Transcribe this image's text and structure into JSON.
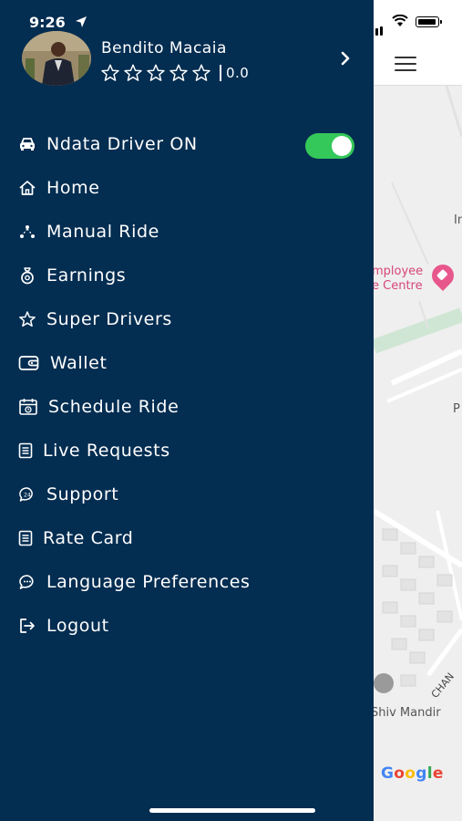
{
  "status_bar": {
    "time": "9:26"
  },
  "profile": {
    "name": "Bendito Macaia",
    "rating": "0.0",
    "stars_total": 5,
    "stars_filled": 0
  },
  "menu": {
    "items": [
      {
        "id": "driver-status",
        "label": "Ndata Driver ON",
        "icon": "car-icon"
      },
      {
        "id": "home",
        "label": "Home",
        "icon": "home-icon"
      },
      {
        "id": "manual-ride",
        "label": "Manual Ride",
        "icon": "route-icon"
      },
      {
        "id": "earnings",
        "label": "Earnings",
        "icon": "money-bag-icon"
      },
      {
        "id": "super-drivers",
        "label": "Super Drivers",
        "icon": "star-icon"
      },
      {
        "id": "wallet",
        "label": "Wallet",
        "icon": "wallet-icon"
      },
      {
        "id": "schedule-ride",
        "label": "Schedule Ride",
        "icon": "calendar-icon"
      },
      {
        "id": "live-requests",
        "label": "Live Requests",
        "icon": "list-icon"
      },
      {
        "id": "support",
        "label": "Support",
        "icon": "support-icon"
      },
      {
        "id": "rate-card",
        "label": "Rate Card",
        "icon": "list-icon"
      },
      {
        "id": "language",
        "label": "Language Preferences",
        "icon": "chat-icon"
      },
      {
        "id": "logout",
        "label": "Logout",
        "icon": "logout-icon"
      }
    ],
    "driver_toggle_on": true
  },
  "map": {
    "labels": {
      "employee_line1": "mployee",
      "employee_line2": "e Centre",
      "edge_in": "In",
      "edge_p": "P",
      "temple": "Shiv Mandir",
      "street": "CHAN"
    },
    "attribution": "Google"
  },
  "colors": {
    "drawer_bg": "#032d51",
    "toggle_on": "#34c759",
    "poi": "#d6457a"
  }
}
